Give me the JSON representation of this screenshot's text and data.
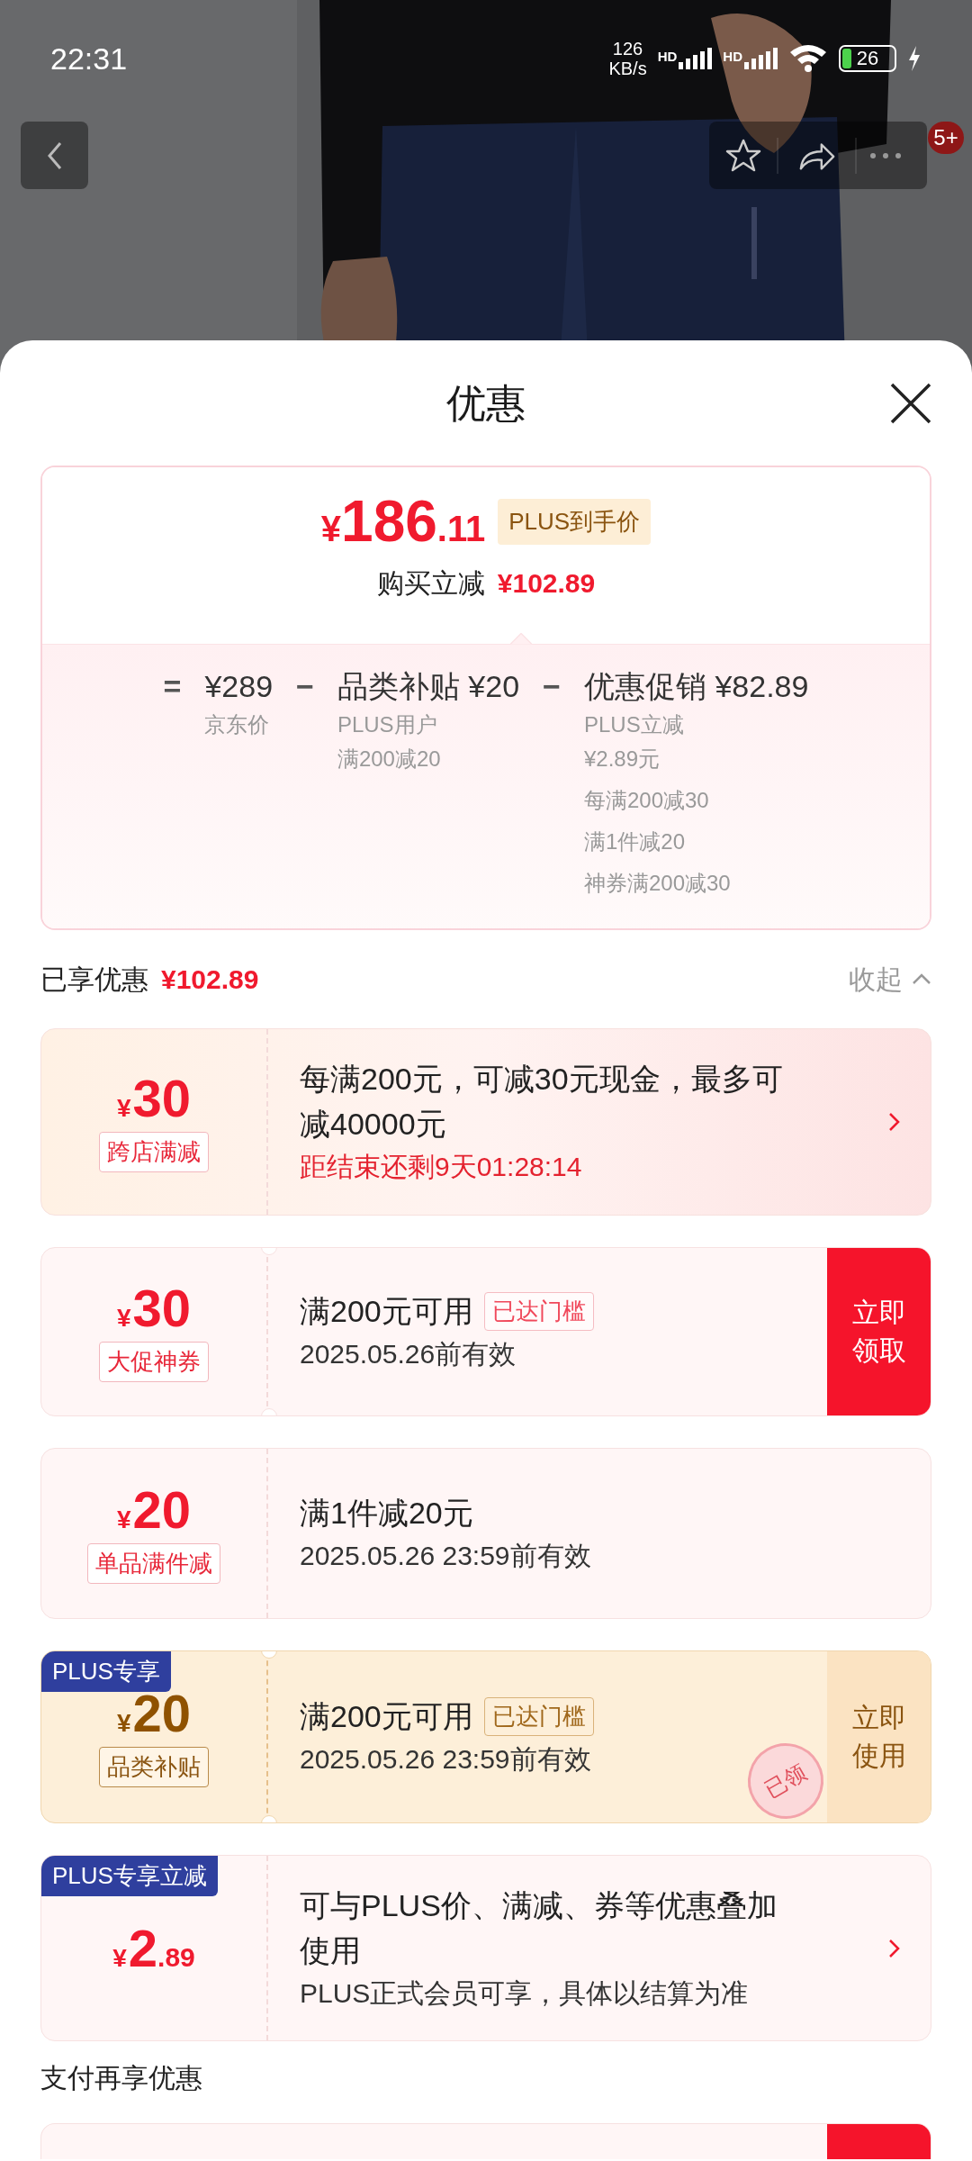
{
  "status_bar": {
    "time": "22:31",
    "speed_value": "126",
    "speed_unit": "KB/s",
    "signals": [
      {
        "label": "HD"
      },
      {
        "label": "HD"
      }
    ],
    "battery": "26"
  },
  "nav": {
    "badge": "5+"
  },
  "sheet": {
    "title": "优惠"
  },
  "summary": {
    "currency": "¥",
    "price_integer": "186",
    "price_decimal": ".11",
    "price_badge": "PLUS到手价",
    "saving_label": "购买立减",
    "saving_amount": "¥102.89",
    "breakdown": [
      {
        "operator": "=",
        "value": "¥289",
        "notes": [
          [
            "京东价"
          ]
        ]
      },
      {
        "operator": "−",
        "value": "品类补贴 ¥20",
        "notes": [
          [
            "PLUS用户",
            "满200减20"
          ]
        ]
      },
      {
        "operator": "−",
        "value": "优惠促销 ¥82.89",
        "notes": [
          [
            "PLUS立减",
            "¥2.89元"
          ],
          [
            "每满200减30"
          ],
          [
            "满1件减20"
          ],
          [
            "神券满200减30"
          ]
        ]
      }
    ]
  },
  "enjoyed": {
    "label": "已享优惠",
    "amount": "¥102.89",
    "toggle": "收起"
  },
  "coupons": [
    {
      "kind": "promo",
      "currency": "¥",
      "amount": "30",
      "tag": "跨店满减",
      "title": "每满200元，可减30元现金，最多可减40000元",
      "countdown": "距结束还剩9天01:28:14",
      "trailing": {
        "kind": "chevron"
      }
    },
    {
      "kind": "ticket",
      "currency": "¥",
      "amount": "30",
      "tag": "大促神券",
      "title": "满200元可用",
      "badge": "已达门槛",
      "validity": "2025.05.26前有效",
      "trailing": {
        "kind": "button",
        "label": "立即领取"
      }
    },
    {
      "kind": "item",
      "currency": "¥",
      "amount": "20",
      "tag": "单品满件减",
      "title": "满1件减20元",
      "validity": "2025.05.26 23:59前有效"
    },
    {
      "kind": "plus_ticket",
      "corner_tag": "PLUS专享",
      "currency": "¥",
      "amount": "20",
      "tag": "品类补贴",
      "title": "满200元可用",
      "badge": "已达门槛",
      "validity": "2025.05.26 23:59前有效",
      "stamp": "已领",
      "trailing": {
        "kind": "button",
        "label": "立即使用"
      }
    },
    {
      "kind": "plus_instant",
      "corner_tag": "PLUS专享立减",
      "currency": "¥",
      "amount": "2",
      "amount_decimal": ".89",
      "title": "可与PLUS价、满减、券等优惠叠加使用",
      "validity": "PLUS正式会员可享，具体以结算为准",
      "trailing": {
        "kind": "chevron"
      }
    }
  ],
  "payment_section": {
    "title": "支付再享优惠"
  }
}
